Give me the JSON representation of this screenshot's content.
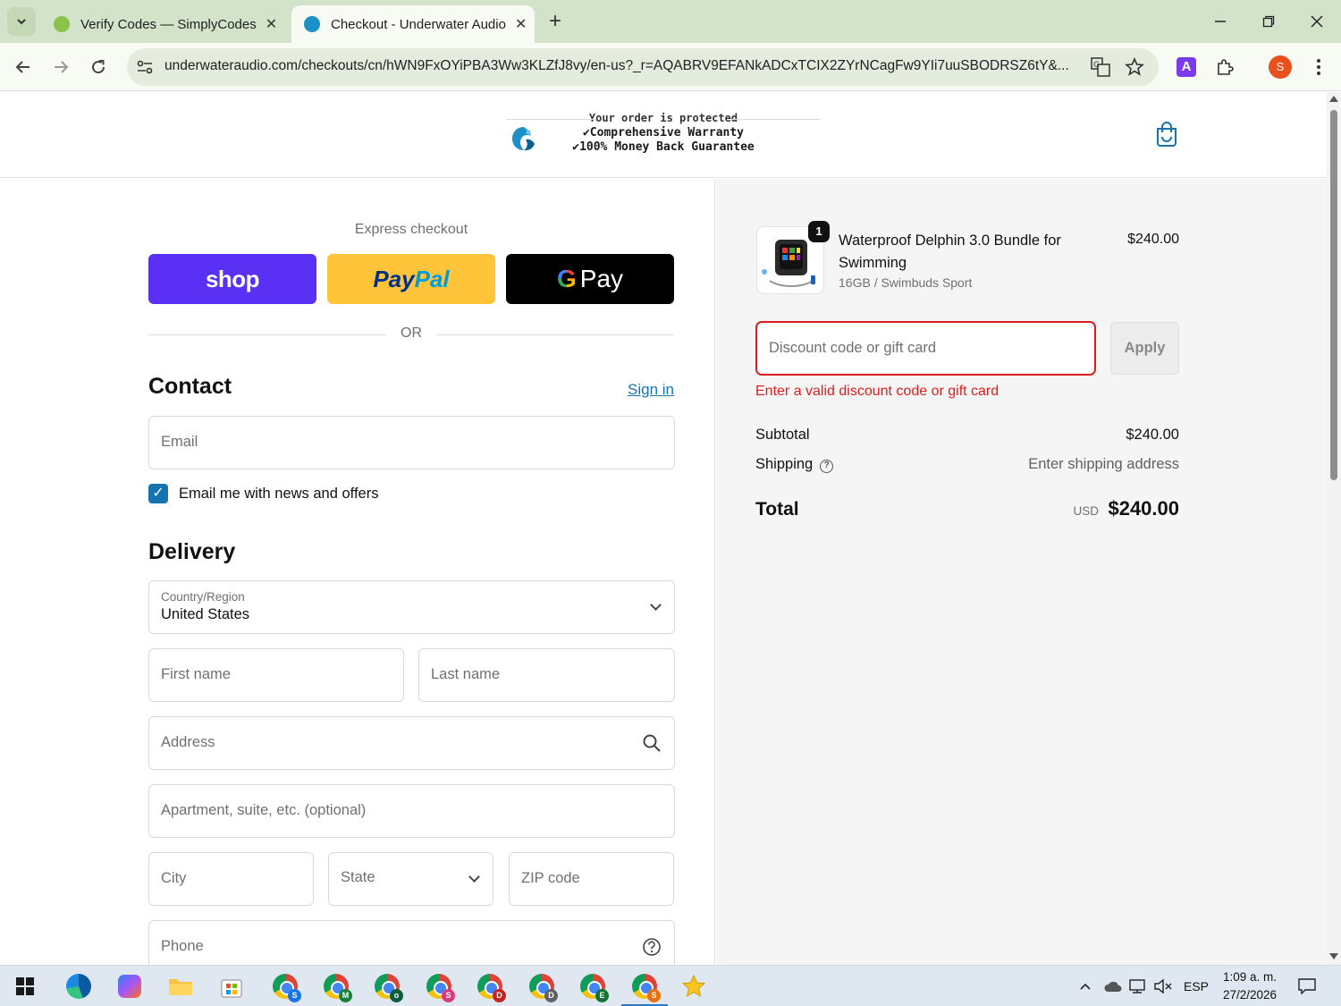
{
  "browser": {
    "tabs": [
      {
        "title": "Verify Codes — SimplyCodes",
        "active": false
      },
      {
        "title": "Checkout - Underwater Audio",
        "active": true
      }
    ],
    "url": "underwateraudio.com/checkouts/cn/hWN9FxOYiPBA3Ww3KLZfJ8vy/en-us?_r=AQABRV9EFANkADCxTCIX2ZYrNCagFw9YIi7uuSBODRSZ6tY&...",
    "profile_initial": "S",
    "extension_letter": "A"
  },
  "header": {
    "protected": "Your order is protected",
    "line1": "✔Comprehensive Warranty",
    "line2": "✔100% Money Back Guarantee"
  },
  "express": {
    "label": "Express checkout",
    "shop": "shop",
    "paypal_a": "Pay",
    "paypal_b": "Pal",
    "gpay_g": "G",
    "gpay_text": "Pay",
    "or": "OR"
  },
  "contact": {
    "title": "Contact",
    "signin": "Sign in",
    "email_placeholder": "Email",
    "newsletter": "Email me with news and offers",
    "newsletter_checked": true
  },
  "delivery": {
    "title": "Delivery",
    "country_label": "Country/Region",
    "country_value": "United States",
    "first_name": "First name",
    "last_name": "Last name",
    "address": "Address",
    "apartment": "Apartment, suite, etc. (optional)",
    "city": "City",
    "state": "State",
    "zip": "ZIP code",
    "phone": "Phone"
  },
  "summary": {
    "qty": "1",
    "product_name": "Waterproof Delphin 3.0 Bundle for Swimming",
    "variant": "16GB / Swimbuds Sport",
    "price": "$240.00",
    "discount_placeholder": "Discount code or gift card",
    "apply": "Apply",
    "error": "Enter a valid discount code or gift card",
    "subtotal_label": "Subtotal",
    "subtotal_value": "$240.00",
    "shipping_label": "Shipping",
    "shipping_value": "Enter shipping address",
    "total_label": "Total",
    "currency": "USD",
    "total_value": "$240.00"
  },
  "taskbar": {
    "apps": [
      {
        "name": "chrome-s",
        "badge": "S",
        "color": "#1a73e8"
      },
      {
        "name": "chrome-m",
        "badge": "M",
        "color": "#188038"
      },
      {
        "name": "chrome-o",
        "badge": "o",
        "color": "#0b5d3b"
      },
      {
        "name": "chrome-s2",
        "badge": "S",
        "color": "#d93b79"
      },
      {
        "name": "chrome-d",
        "badge": "D",
        "color": "#c5221f"
      },
      {
        "name": "chrome-d2",
        "badge": "D",
        "color": "#5f6368"
      },
      {
        "name": "chrome-e",
        "badge": "E",
        "color": "#137333"
      },
      {
        "name": "chrome-s3",
        "badge": "S",
        "color": "#e8710a"
      }
    ],
    "language": "ESP",
    "time": "1:09 a. m.",
    "date": "27/2/2026"
  },
  "colors": {
    "accent": "#1773b0",
    "error": "#dd1d1d",
    "shop": "#5a31f4",
    "paypal": "#ffc439"
  }
}
